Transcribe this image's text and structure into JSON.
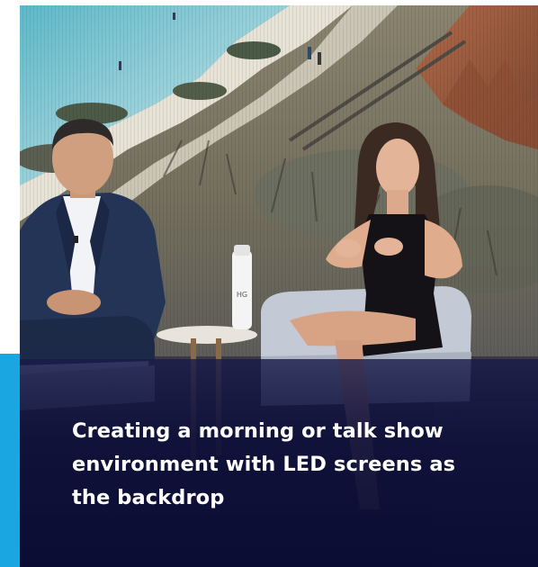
{
  "caption": {
    "text": "Creating a morning or talk show environment with LED screens as the backdrop"
  },
  "bottle": {
    "label": "HG"
  },
  "colors": {
    "accent": "#1aa6e0",
    "caption_background": "#0e103a",
    "caption_text": "#ffffff"
  }
}
